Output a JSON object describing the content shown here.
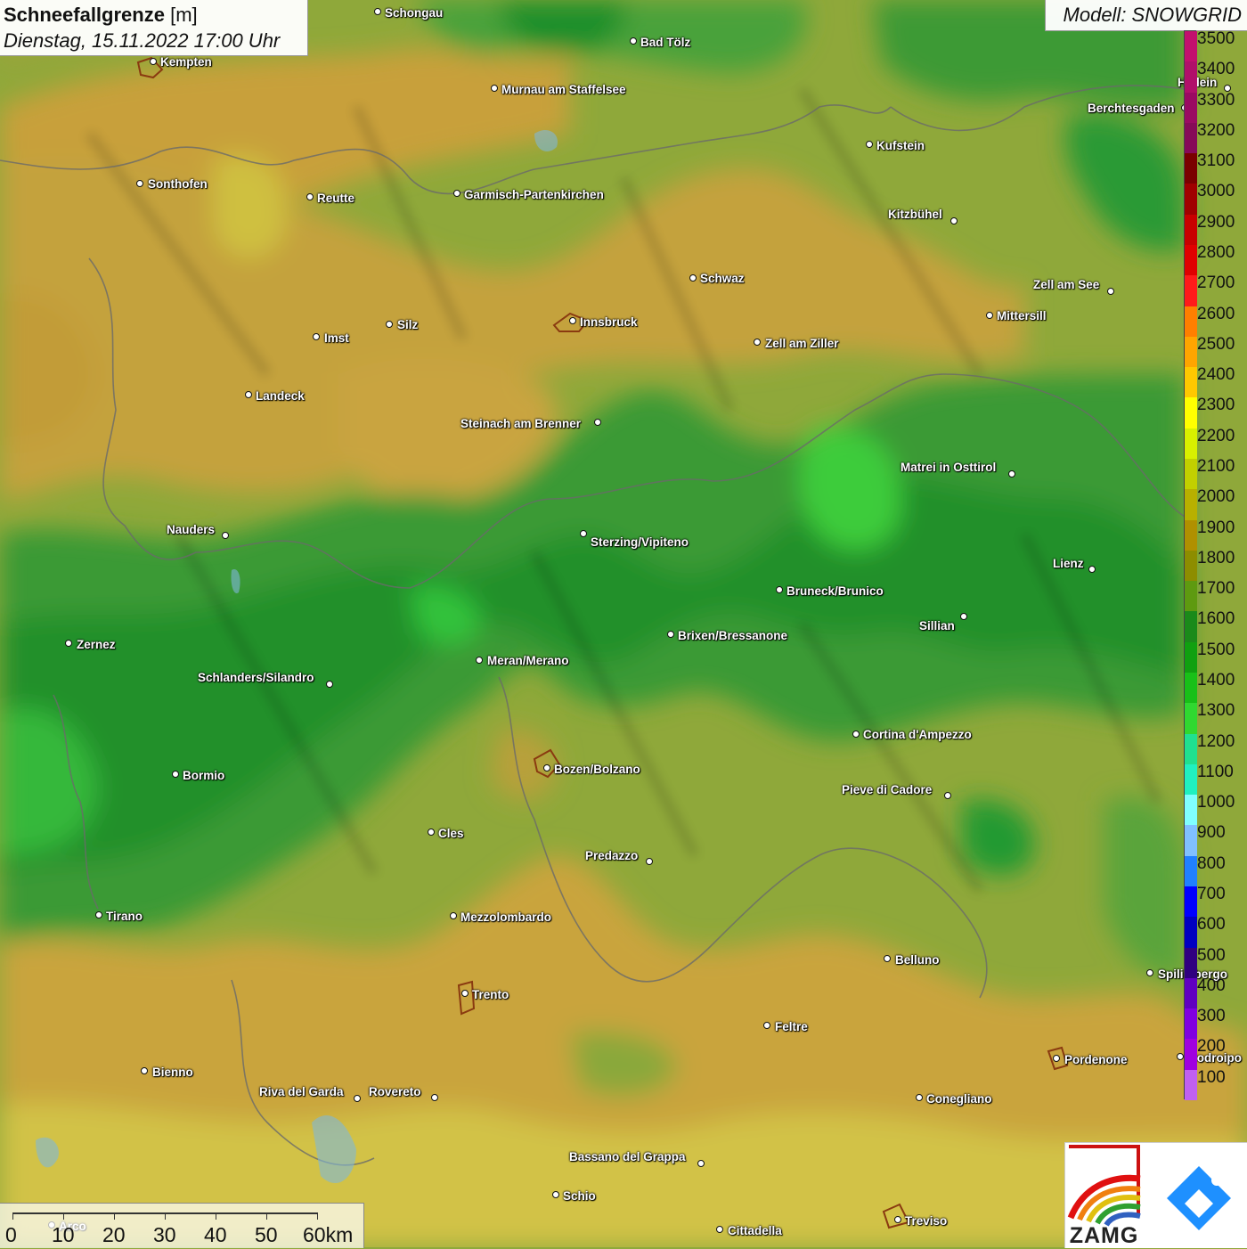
{
  "title": {
    "name": "Schneefallgrenze",
    "unit": "[m]",
    "datetime": "Dienstag, 15.11.2022 17:00 Uhr"
  },
  "model": "Modell: SNOWGRID",
  "legend": {
    "levels": [
      "3500",
      "3400",
      "3300",
      "3200",
      "3100",
      "3000",
      "2900",
      "2800",
      "2700",
      "2600",
      "2500",
      "2400",
      "2300",
      "2200",
      "2100",
      "2000",
      "1900",
      "1800",
      "1700",
      "1600",
      "1500",
      "1400",
      "1300",
      "1200",
      "1100",
      "1000",
      "900",
      "800",
      "700",
      "600",
      "500",
      "400",
      "300",
      "200",
      "100"
    ],
    "colors": [
      "#c2106e",
      "#b0106a",
      "#9a0a62",
      "#860a58",
      "#7a0000",
      "#a00000",
      "#c80000",
      "#e00000",
      "#ff1a1a",
      "#ff7f00",
      "#ffa500",
      "#ffc800",
      "#ffff00",
      "#d8f000",
      "#c2d000",
      "#b8b000",
      "#b09000",
      "#8d8d00",
      "#5e9a10",
      "#1a8a1a",
      "#10a010",
      "#18c018",
      "#30d830",
      "#20e090",
      "#20f0c0",
      "#80ffff",
      "#80c0ff",
      "#2080ff",
      "#0000ff",
      "#0000c0",
      "#300080",
      "#6000c0",
      "#8000e0",
      "#a000e0",
      "#c060f0"
    ]
  },
  "cities": [
    {
      "name": "Schongau"
    },
    {
      "name": "Bad Tölz"
    },
    {
      "name": "Kempten"
    },
    {
      "name": "Murnau am Staffelsee"
    },
    {
      "name": "Hallein"
    },
    {
      "name": "Berchtesgaden"
    },
    {
      "name": "Kufstein"
    },
    {
      "name": "Sonthofen"
    },
    {
      "name": "Reutte"
    },
    {
      "name": "Garmisch-Partenkirchen"
    },
    {
      "name": "Kitzbühel"
    },
    {
      "name": "Schwaz"
    },
    {
      "name": "Zell am See"
    },
    {
      "name": "Innsbruck"
    },
    {
      "name": "Mittersill"
    },
    {
      "name": "Silz"
    },
    {
      "name": "Imst"
    },
    {
      "name": "Zell am Ziller"
    },
    {
      "name": "Landeck"
    },
    {
      "name": "Steinach am Brenner"
    },
    {
      "name": "Matrei in Osttirol"
    },
    {
      "name": "Nauders"
    },
    {
      "name": "Sterzing/Vipiteno"
    },
    {
      "name": "Lienz"
    },
    {
      "name": "Bruneck/Brunico"
    },
    {
      "name": "Sillian"
    },
    {
      "name": "Brixen/Bressanone"
    },
    {
      "name": "Zernez"
    },
    {
      "name": "Meran/Merano"
    },
    {
      "name": "Schlanders/Silandro"
    },
    {
      "name": "Cortina d'Ampezzo"
    },
    {
      "name": "Bozen/Bolzano"
    },
    {
      "name": "Bormio"
    },
    {
      "name": "Pieve di Cadore"
    },
    {
      "name": "Cles"
    },
    {
      "name": "Predazzo"
    },
    {
      "name": "Tirano"
    },
    {
      "name": "Mezzolombardo"
    },
    {
      "name": "Belluno"
    },
    {
      "name": "Spilimbergo"
    },
    {
      "name": "Trento"
    },
    {
      "name": "Feltre"
    },
    {
      "name": "Pordenone"
    },
    {
      "name": "Codroipo"
    },
    {
      "name": "Bienno"
    },
    {
      "name": "Riva del Garda"
    },
    {
      "name": "Rovereto"
    },
    {
      "name": "Conegliano"
    },
    {
      "name": "Bassano del Grappa"
    },
    {
      "name": "Schio"
    },
    {
      "name": "Treviso"
    },
    {
      "name": "Cittadella"
    },
    {
      "name": "Arco"
    }
  ],
  "scale": {
    "labels": [
      "0",
      "10",
      "20",
      "30",
      "40",
      "50",
      "60km"
    ]
  },
  "logos": {
    "zamg_text": "ZAMG",
    "zamg_icon": "zamg-rainbow-logo",
    "partner_icon": "blue-diamond-logo"
  }
}
